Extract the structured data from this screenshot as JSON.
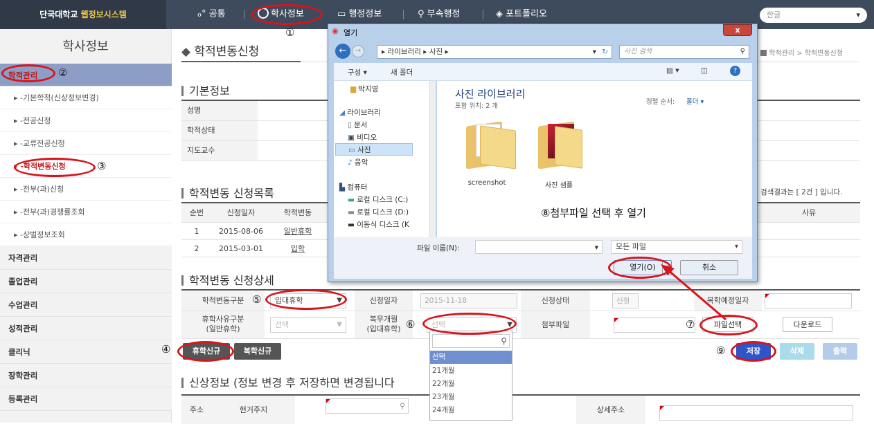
{
  "topbar": {
    "brand_prefix": "단국대학교 ",
    "brand_highlight": "웹정보시스템",
    "nav": [
      "공통",
      "학사정보",
      "행정정보",
      "부속행정",
      "포트폴리오"
    ],
    "language": "한글"
  },
  "sidebar": {
    "title": "학사정보",
    "active_main": "학적관리",
    "sub_items": [
      "-기본학적(신상정보변경)",
      "-전공신청",
      "-교류전공신청",
      "-학적변동신청",
      "-전부(과)신청",
      "-전부(과)경쟁률조회",
      "-상벌정보조회"
    ],
    "other_main": [
      "자격관리",
      "졸업관리",
      "수업관리",
      "성적관리",
      "클리닉",
      "장학관리",
      "등록관리"
    ]
  },
  "page": {
    "title": "학적변동신청",
    "breadcrumb": "학적관리 > 학적변동신청"
  },
  "basic_info": {
    "heading": "기본정보",
    "labels": [
      "성명",
      "학적상태",
      "지도교수"
    ]
  },
  "apply_list": {
    "heading": "학적변동 신청목록",
    "result_text": "검색결과는 [ 2건 ] 입니다.",
    "columns": [
      "순번",
      "신청일자",
      "학적변동",
      "사유"
    ],
    "rows": [
      {
        "no": "1",
        "date": "2015-08-06",
        "type": "일반휴학"
      },
      {
        "no": "2",
        "date": "2015-03-01",
        "type": "입학"
      }
    ]
  },
  "detail": {
    "heading": "학적변동 신청상세",
    "type_label": "학적변동구분",
    "type_value": "입대휴학",
    "date_label": "신청일자",
    "date_value": "2015-11-18",
    "status_label": "신청상태",
    "status_value": "신청",
    "return_label": "복학예정일자",
    "reason_label": "휴학사유구분\n(일반휴학)",
    "reason_value": "선택",
    "months_label": "복무개월\n(입대휴학)",
    "months_value": "선택",
    "attach_label": "첨부파일",
    "file_btn": "파일선택",
    "download_btn": "다운로드"
  },
  "buttons": {
    "leave_new": "휴학신규",
    "return_new": "복학신규",
    "save": "저장",
    "delete": "삭제",
    "print": "출력"
  },
  "personal": {
    "heading": "신상정보 (정보 변경 후 저장하면 변경됩니다",
    "addr_label": "주소",
    "current_label": "현거주지",
    "detail_label": "상세주소"
  },
  "dropdown": {
    "options": [
      "선택",
      "21개월",
      "22개월",
      "23개월",
      "24개월"
    ]
  },
  "dialog": {
    "title": "열기",
    "breadcrumb": "▸ 라이브러리 ▸ 사진 ▸",
    "search_placeholder": "사진 검색",
    "organize": "구성 ▾",
    "new_folder": "새 폴더",
    "tree": [
      "박지영",
      "라이브러리",
      "문서",
      "비디오",
      "사진",
      "음악",
      "컴퓨터",
      "로컬 디스크 (C:)",
      "로컬 디스크 (D:)",
      "이동식 디스크 (K"
    ],
    "lib_title": "사진 라이브러리",
    "lib_sub": "포함 위치: 2 개",
    "sort_label": "정렬 순서:",
    "sort_value": "폴더 ▾",
    "folders": [
      "screenshot",
      "사진 샘플"
    ],
    "filename_label": "파일 이름(N):",
    "filter": "모든 파일",
    "open_btn": "열기(O)",
    "cancel_btn": "취소"
  },
  "annotations": {
    "n1": "①",
    "n2": "②",
    "n3": "③",
    "n4": "④",
    "n5": "⑤",
    "n6": "⑥",
    "n7": "⑦",
    "n9": "⑨",
    "step8": "⑧첨부파일 선택 후 열기"
  }
}
